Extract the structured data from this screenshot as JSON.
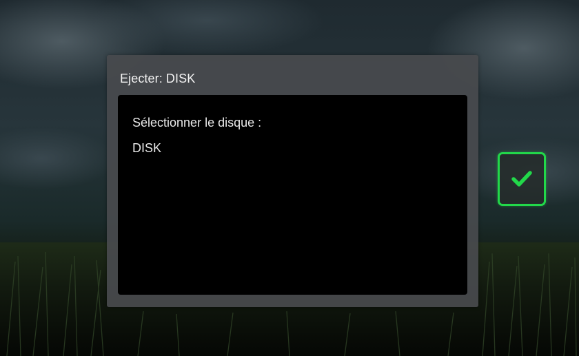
{
  "dialog": {
    "title": "Ejecter: DISK",
    "prompt": "Sélectionner le disque :",
    "items": [
      {
        "label": "DISK"
      }
    ]
  },
  "confirm": {
    "icon": "checkmark-icon"
  },
  "colors": {
    "accent": "#22d84a",
    "dialog_bg": "#484a4e",
    "body_bg": "#000000",
    "text": "#e9e9e9"
  }
}
